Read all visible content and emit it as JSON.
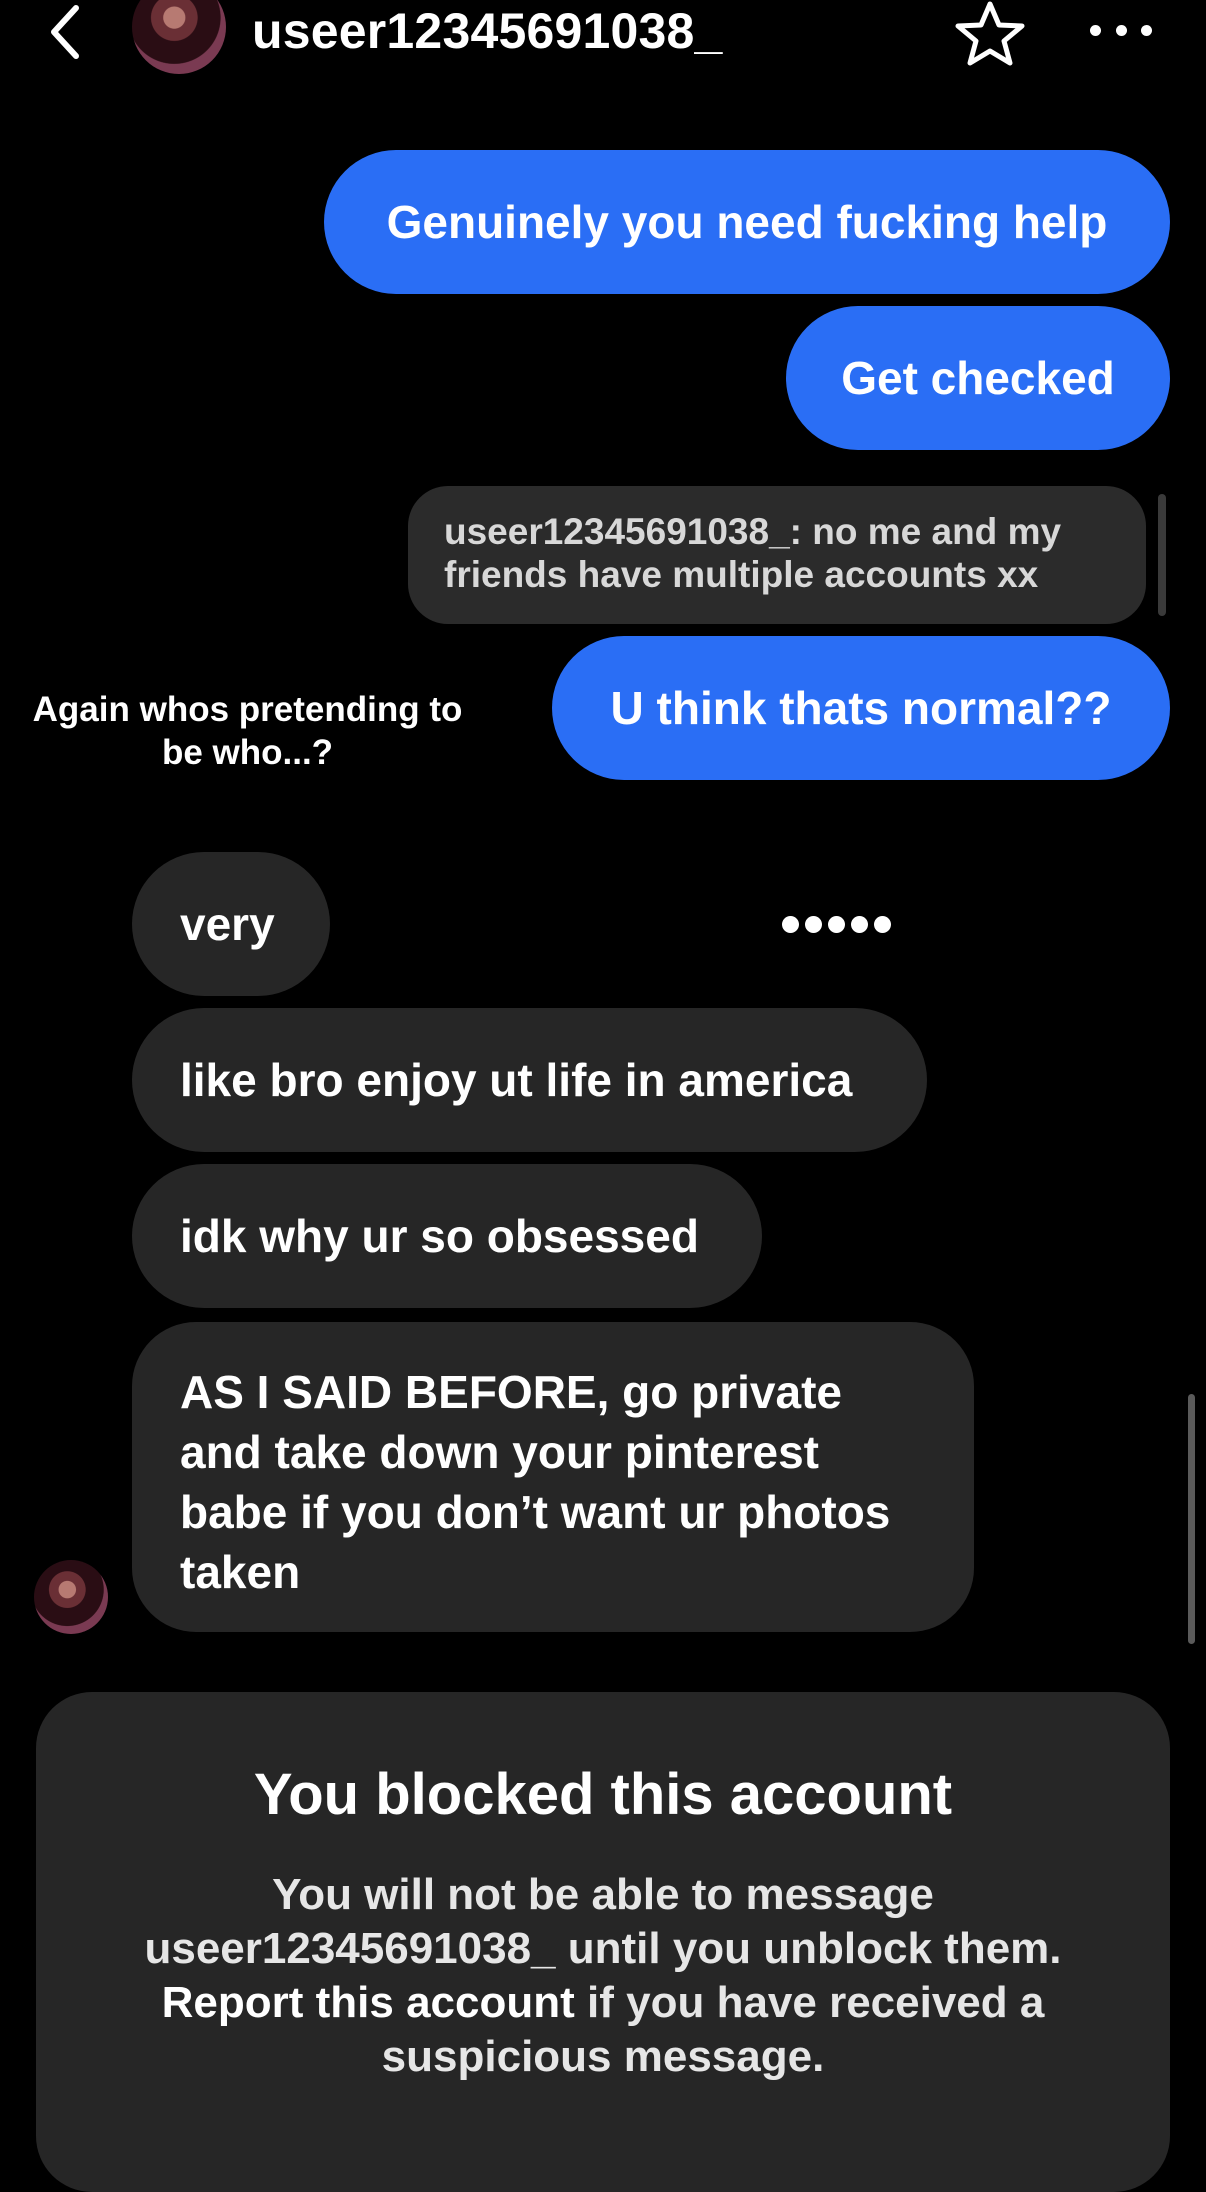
{
  "header": {
    "username": "useer12345691038_",
    "back_icon": "chevron-left-icon",
    "star_icon": "star-outline-icon",
    "more_icon": "ellipsis-icon"
  },
  "messages": {
    "sent": [
      "Genuinely you need fucking help",
      "Get checked",
      "U think thats normal??"
    ],
    "reply_preview": "useer12345691038_: no me and my friends have multiple accounts xx",
    "side_note": "Again whos pretending to be who...?",
    "received": [
      "very",
      "like bro enjoy ut life in america",
      "idk why ur so obsessed",
      "AS I SAID BEFORE, go private and take down your pinterest babe if you don’t want ur photos taken"
    ]
  },
  "blocked": {
    "title": "You blocked this account",
    "line1": "You will not be able to message useer12345691038_ until you unblock them.",
    "report_link": "Report this account",
    "line2": "if you have received a suspicious message."
  },
  "colors": {
    "background": "#000000",
    "sent_bubble": "#2a6ef5",
    "received_bubble": "#262626",
    "panel": "#262626"
  }
}
